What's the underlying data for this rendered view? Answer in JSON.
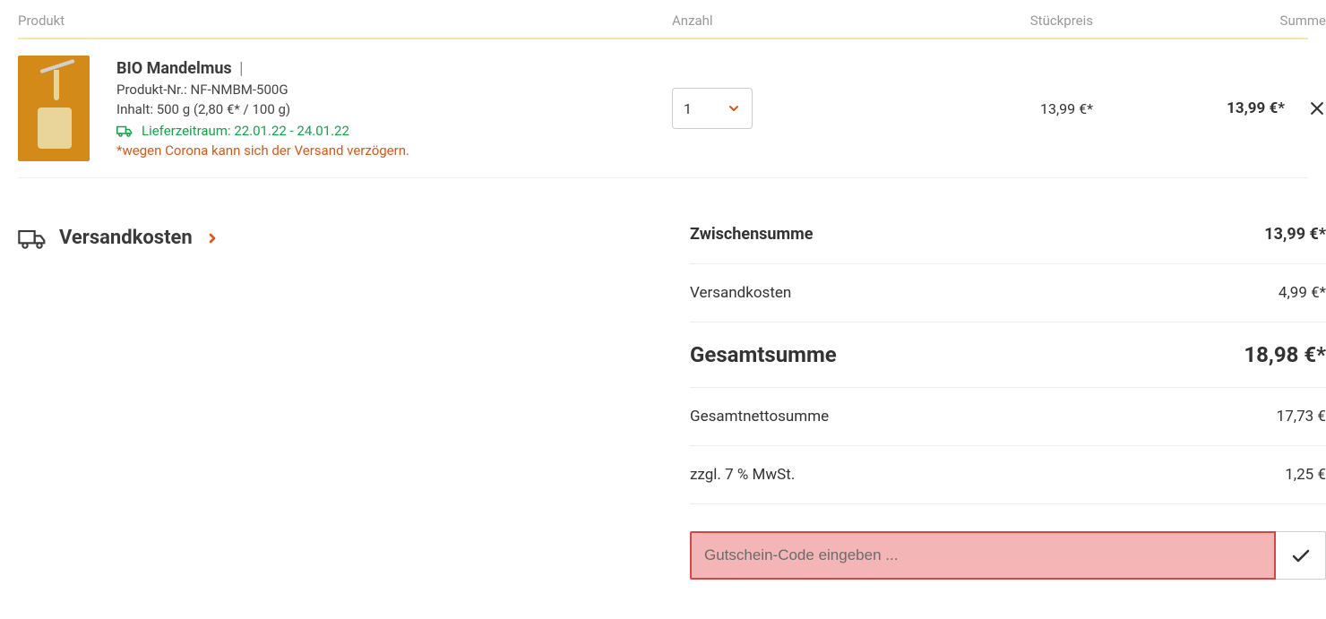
{
  "headers": {
    "product": "Produkt",
    "quantity": "Anzahl",
    "unit_price": "Stückpreis",
    "sum": "Summe"
  },
  "item": {
    "title": "BIO Mandelmus",
    "separator": "|",
    "product_no": "Produkt-Nr.: NF-NMBM-500G",
    "content": "Inhalt: 500 g (2,80 €* / 100 g)",
    "delivery": "Lieferzeitraum: 22.01.22 - 24.01.22",
    "note": "*wegen Corona kann sich der Versand verzögern.",
    "qty": "1",
    "unit_price": "13,99 €*",
    "sum": "13,99 €*"
  },
  "shipping_link": "Versandkosten",
  "summary": {
    "subtotal_label": "Zwischensumme",
    "subtotal_value": "13,99 €*",
    "shipping_label": "Versandkosten",
    "shipping_value": "4,99 €*",
    "total_label": "Gesamtsumme",
    "total_value": "18,98 €*",
    "net_label": "Gesamtnettosumme",
    "net_value": "17,73 €",
    "vat_label": "zzgl. 7 % MwSt.",
    "vat_value": "1,25 €"
  },
  "coupon": {
    "placeholder": "Gutschein-Code eingeben ..."
  }
}
